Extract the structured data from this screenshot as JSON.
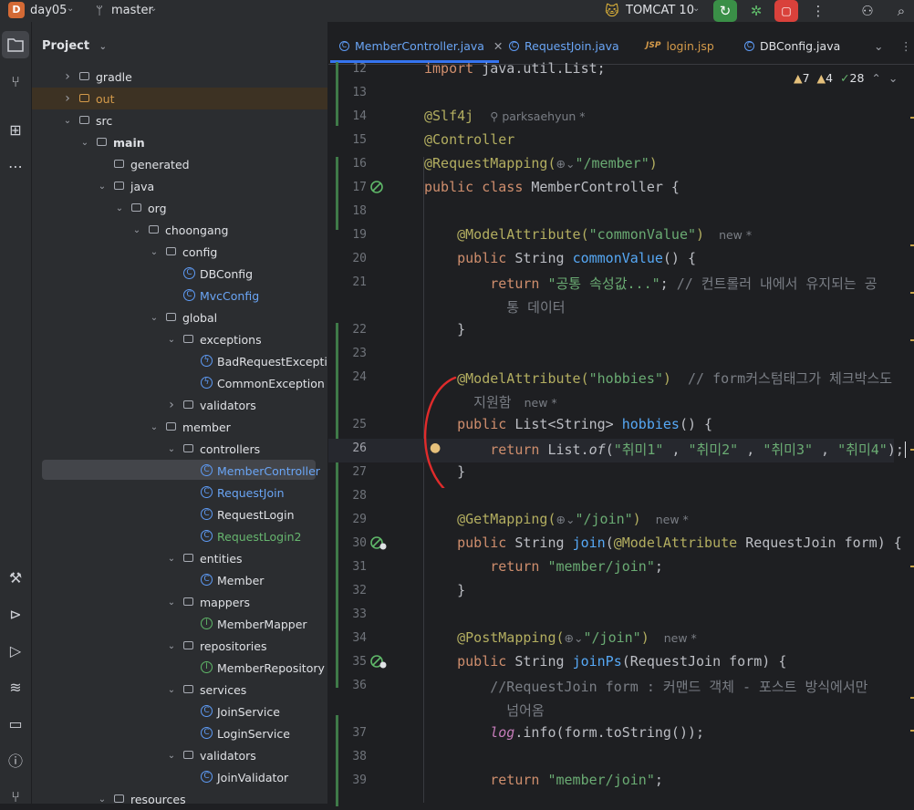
{
  "titlebar": {
    "project_badge": "D",
    "project_name": "day05",
    "branch": "master",
    "run_config": "TOMCAT 10"
  },
  "project_panel": {
    "title": "Project",
    "tree": [
      {
        "label": "gradle",
        "kind": "folder",
        "depth": 1,
        "expanded": false
      },
      {
        "label": "out",
        "kind": "folder-out",
        "depth": 1,
        "expanded": false
      },
      {
        "label": "src",
        "kind": "folder",
        "depth": 1,
        "expanded": true
      },
      {
        "label": "main",
        "kind": "folder",
        "depth": 2,
        "expanded": true
      },
      {
        "label": "generated",
        "kind": "folder",
        "depth": 3,
        "expanded": null
      },
      {
        "label": "java",
        "kind": "folder",
        "depth": 3,
        "expanded": true
      },
      {
        "label": "org",
        "kind": "folder",
        "depth": 4,
        "expanded": true
      },
      {
        "label": "choongang",
        "kind": "folder",
        "depth": 5,
        "expanded": true
      },
      {
        "label": "config",
        "kind": "folder",
        "depth": 6,
        "expanded": true
      },
      {
        "label": "DBConfig",
        "kind": "class",
        "depth": 7,
        "color": "normal"
      },
      {
        "label": "MvcConfig",
        "kind": "class",
        "depth": 7,
        "color": "blue"
      },
      {
        "label": "global",
        "kind": "folder",
        "depth": 6,
        "expanded": true
      },
      {
        "label": "exceptions",
        "kind": "folder",
        "depth": 7,
        "expanded": true
      },
      {
        "label": "BadRequestException",
        "kind": "exception",
        "depth": 8,
        "color": "normal"
      },
      {
        "label": "CommonException",
        "kind": "exception",
        "depth": 8,
        "color": "normal"
      },
      {
        "label": "validators",
        "kind": "folder",
        "depth": 7,
        "expanded": false
      },
      {
        "label": "member",
        "kind": "folder",
        "depth": 6,
        "expanded": true
      },
      {
        "label": "controllers",
        "kind": "folder",
        "depth": 7,
        "expanded": true
      },
      {
        "label": "MemberController",
        "kind": "class",
        "depth": 8,
        "color": "blue",
        "selected": true
      },
      {
        "label": "RequestJoin",
        "kind": "class",
        "depth": 8,
        "color": "blue"
      },
      {
        "label": "RequestLogin",
        "kind": "class",
        "depth": 8,
        "color": "normal"
      },
      {
        "label": "RequestLogin2",
        "kind": "class",
        "depth": 8,
        "color": "green"
      },
      {
        "label": "entities",
        "kind": "folder",
        "depth": 7,
        "expanded": true
      },
      {
        "label": "Member",
        "kind": "class",
        "depth": 8,
        "color": "normal"
      },
      {
        "label": "mappers",
        "kind": "folder",
        "depth": 7,
        "expanded": true
      },
      {
        "label": "MemberMapper",
        "kind": "interface",
        "depth": 8,
        "color": "normal"
      },
      {
        "label": "repositories",
        "kind": "folder",
        "depth": 7,
        "expanded": true
      },
      {
        "label": "MemberRepository",
        "kind": "interface",
        "depth": 8,
        "color": "normal"
      },
      {
        "label": "services",
        "kind": "folder",
        "depth": 7,
        "expanded": true
      },
      {
        "label": "JoinService",
        "kind": "class",
        "depth": 8,
        "color": "normal"
      },
      {
        "label": "LoginService",
        "kind": "class",
        "depth": 8,
        "color": "normal"
      },
      {
        "label": "validators",
        "kind": "folder",
        "depth": 7,
        "expanded": true
      },
      {
        "label": "JoinValidator",
        "kind": "class",
        "depth": 8,
        "color": "normal"
      },
      {
        "label": "resources",
        "kind": "folder",
        "depth": 3,
        "expanded": true
      }
    ]
  },
  "tabs": [
    {
      "label": "MemberController.java",
      "active": true,
      "icon": "class-icon"
    },
    {
      "label": "RequestJoin.java",
      "active": false,
      "icon": "class-icon"
    },
    {
      "label": "login.jsp",
      "active": false,
      "icon": "jsp-icon"
    },
    {
      "label": "DBConfig.java",
      "active": false,
      "icon": "class-icon"
    }
  ],
  "inspections": {
    "warnings": "7",
    "weak_warnings": "4",
    "typos": "28"
  },
  "meta": {
    "author": "parksaehyun *",
    "new": "new *"
  },
  "code_lines": [
    {
      "n": "12",
      "parts": [
        [
          "kw",
          "import "
        ],
        [
          "",
          "java.util.List;"
        ]
      ]
    },
    {
      "n": "13",
      "parts": []
    },
    {
      "n": "14",
      "parts": [
        [
          "an",
          "@Slf4j"
        ]
      ],
      "author": true
    },
    {
      "n": "15",
      "parts": [
        [
          "an",
          "@Controller"
        ]
      ]
    },
    {
      "n": "16",
      "parts": [
        [
          "an",
          "@RequestMapping("
        ],
        [
          "gh",
          "⊕⌄"
        ],
        [
          "st",
          "\"/member\""
        ],
        [
          "an",
          ")"
        ]
      ]
    },
    {
      "n": "17",
      "parts": [
        [
          "kw",
          "public class "
        ],
        [
          "",
          "MemberController {"
        ]
      ]
    },
    {
      "n": "18",
      "parts": []
    },
    {
      "n": "19",
      "parts": [
        [
          "",
          "    "
        ],
        [
          "an",
          "@ModelAttribute("
        ],
        [
          "st",
          "\"commonValue\""
        ],
        [
          "an",
          ")"
        ]
      ],
      "newtag": true
    },
    {
      "n": "20",
      "parts": [
        [
          "",
          "    "
        ],
        [
          "kw",
          "public "
        ],
        [
          "",
          "String "
        ],
        [
          "fn",
          "commonValue"
        ],
        [
          "",
          "() {"
        ]
      ]
    },
    {
      "n": "21",
      "parts": [
        [
          "",
          "        "
        ],
        [
          "kw",
          "return "
        ],
        [
          "st",
          "\"공통 속성값...\""
        ],
        [
          "",
          "; "
        ],
        [
          "cm",
          "// 컨트롤러 내에서 유지되는 공"
        ]
      ],
      "wrap": [
        [
          "cm",
          "          통 데이터"
        ]
      ]
    },
    {
      "n": "22",
      "parts": [
        [
          "",
          "    }"
        ]
      ]
    },
    {
      "n": "23",
      "parts": []
    },
    {
      "n": "24",
      "parts": [
        [
          "",
          "    "
        ],
        [
          "an",
          "@ModelAttribute("
        ],
        [
          "st",
          "\"hobbies\""
        ],
        [
          "an",
          ")"
        ],
        [
          "",
          "  "
        ],
        [
          "cm",
          "// form커스텀태그가 체크박스도"
        ]
      ],
      "wrap": [
        [
          "cm",
          "      지원함"
        ]
      ],
      "wrapnew": true
    },
    {
      "n": "25",
      "parts": [
        [
          "",
          "    "
        ],
        [
          "kw",
          "public "
        ],
        [
          "",
          "List<String> "
        ],
        [
          "fn",
          "hobbies"
        ],
        [
          "",
          "() {"
        ]
      ]
    },
    {
      "n": "26",
      "parts": [
        [
          "",
          "        "
        ],
        [
          "kw",
          "return "
        ],
        [
          "",
          "List."
        ],
        [
          "it",
          "of"
        ],
        [
          "",
          "("
        ],
        [
          "st",
          "\"취미1\""
        ],
        [
          "",
          " , "
        ],
        [
          "st",
          "\"취미2\""
        ],
        [
          "",
          " , "
        ],
        [
          "st",
          "\"취미3\""
        ],
        [
          "",
          " , "
        ],
        [
          "st",
          "\"취미4\""
        ],
        [
          "",
          ");"
        ]
      ],
      "current": true
    },
    {
      "n": "27",
      "parts": [
        [
          "",
          "    }"
        ]
      ]
    },
    {
      "n": "28",
      "parts": []
    },
    {
      "n": "29",
      "parts": [
        [
          "",
          "    "
        ],
        [
          "an",
          "@GetMapping("
        ],
        [
          "gh",
          "⊕⌄"
        ],
        [
          "st",
          "\"/join\""
        ],
        [
          "an",
          ")"
        ]
      ],
      "newtag": true
    },
    {
      "n": "30",
      "parts": [
        [
          "",
          "    "
        ],
        [
          "kw",
          "public "
        ],
        [
          "",
          "String "
        ],
        [
          "fn",
          "join"
        ],
        [
          "",
          "("
        ],
        [
          "an",
          "@ModelAttribute "
        ],
        [
          "",
          "RequestJoin form) {"
        ]
      ]
    },
    {
      "n": "31",
      "parts": [
        [
          "",
          "        "
        ],
        [
          "kw",
          "return "
        ],
        [
          "st",
          "\"member/join\""
        ],
        [
          "",
          ";"
        ]
      ]
    },
    {
      "n": "32",
      "parts": [
        [
          "",
          "    }"
        ]
      ]
    },
    {
      "n": "33",
      "parts": []
    },
    {
      "n": "34",
      "parts": [
        [
          "",
          "    "
        ],
        [
          "an",
          "@PostMapping("
        ],
        [
          "gh",
          "⊕⌄"
        ],
        [
          "st",
          "\"/join\""
        ],
        [
          "an",
          ")"
        ]
      ],
      "newtag": true
    },
    {
      "n": "35",
      "parts": [
        [
          "",
          "    "
        ],
        [
          "kw",
          "public "
        ],
        [
          "",
          "String "
        ],
        [
          "fn",
          "joinPs"
        ],
        [
          "",
          "(RequestJoin form) {"
        ]
      ]
    },
    {
      "n": "36",
      "parts": [
        [
          "",
          "        "
        ],
        [
          "cm",
          "//RequestJoin form : 커맨드 객체 - 포스트 방식에서만"
        ]
      ],
      "wrap": [
        [
          "cm",
          "          넘어옴"
        ]
      ]
    },
    {
      "n": "37",
      "parts": [
        [
          "",
          "        "
        ],
        [
          "it kw2",
          "log"
        ],
        [
          "",
          ".info(form.toString());"
        ]
      ]
    },
    {
      "n": "38",
      "parts": []
    },
    {
      "n": "39",
      "parts": [
        [
          "",
          "        "
        ],
        [
          "kw",
          "return "
        ],
        [
          "st",
          "\"member/join\""
        ],
        [
          "",
          ";"
        ]
      ]
    }
  ],
  "colors": {
    "accent": "#3574f0",
    "annotation_bracket": "#e02b2b"
  }
}
